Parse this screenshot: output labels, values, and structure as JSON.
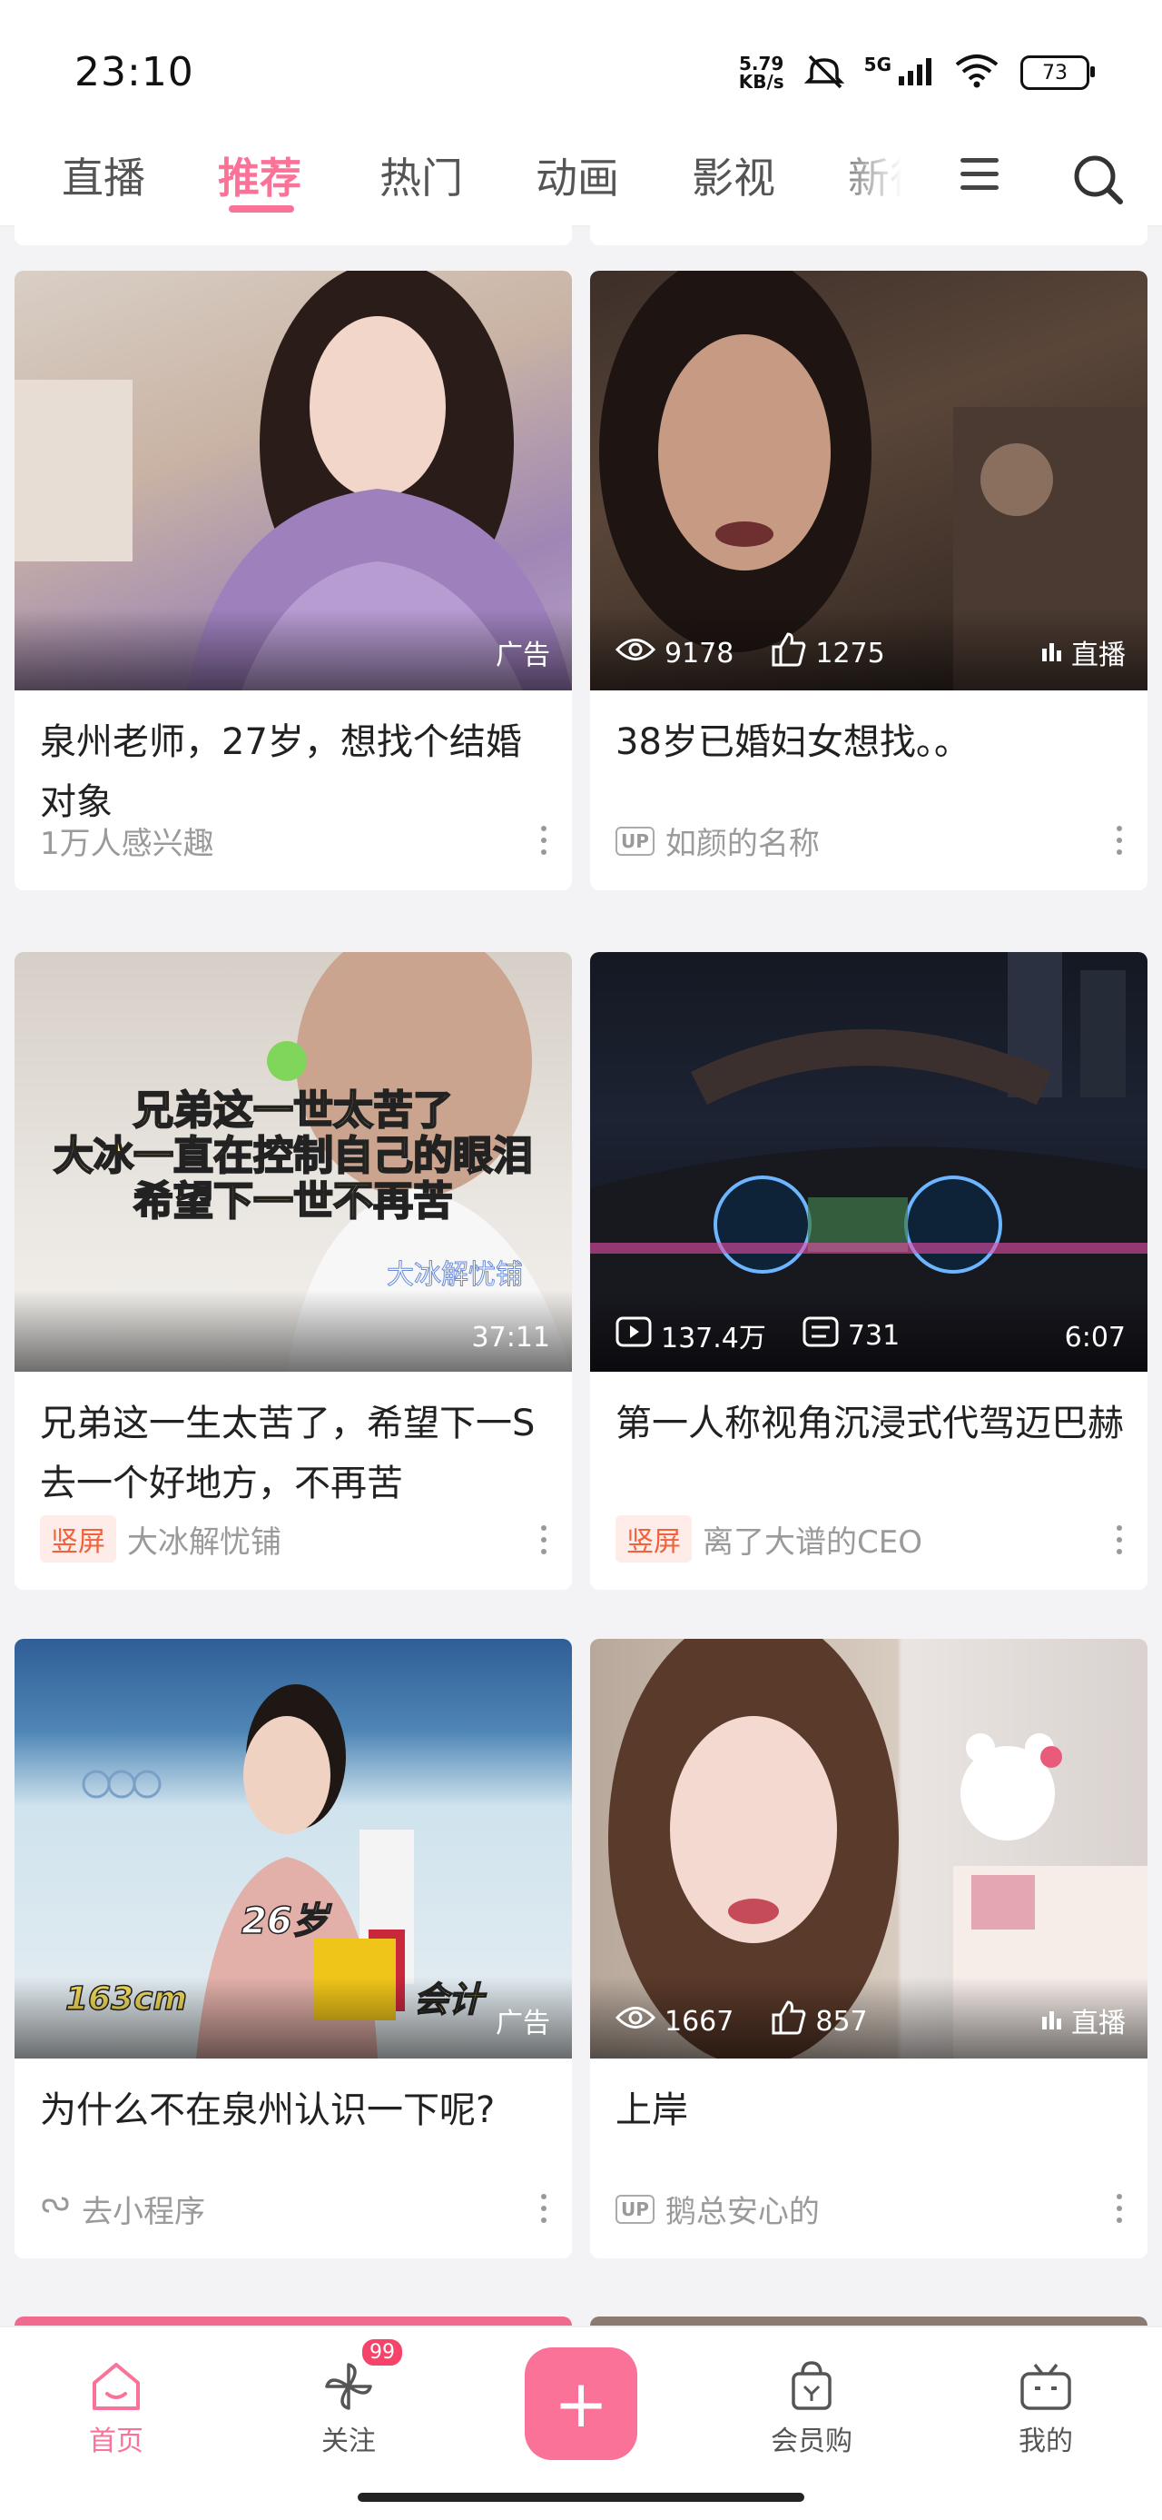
{
  "status_bar": {
    "time": "23:10",
    "net_speed_value": "5.79",
    "net_speed_unit": "KB/s",
    "network": "5G",
    "battery": "73",
    "icons": [
      "mute-icon",
      "signal-icon",
      "wifi-icon",
      "battery-icon"
    ]
  },
  "tabs": [
    {
      "label": "直播",
      "active": false
    },
    {
      "label": "推荐",
      "active": true
    },
    {
      "label": "热门",
      "active": false
    },
    {
      "label": "动画",
      "active": false
    },
    {
      "label": "影视",
      "active": false
    },
    {
      "label": "新征",
      "active": false
    }
  ],
  "accent_color": "#fb7299",
  "cards": [
    {
      "title": "泉州老师，27岁，想找个结婚对象",
      "tag": "广告",
      "meta": "1万人感兴趣"
    },
    {
      "title": "38岁已婚妇女想找。。",
      "views": "9178",
      "likes": "1275",
      "tag": "直播",
      "author": "如颜的名称"
    },
    {
      "title": "兄弟这一生太苦了，希望下一S去一个好地方，不再苦",
      "caption_lines": [
        "兄弟这一世太苦了",
        "大冰一直在控制自己的眼泪",
        "希望下一世不再苦"
      ],
      "watermark": "大冰解忧铺",
      "duration": "37:11",
      "badge": "竖屏",
      "author": "大冰解忧铺"
    },
    {
      "title": "第一人称视角沉浸式代驾迈巴赫",
      "plays": "137.4万",
      "danmaku": "731",
      "duration": "6:07",
      "badge": "竖屏",
      "author": "离了大谱的CEO"
    },
    {
      "title": "为什么不在泉州认识一下呢?",
      "overlay_texts": [
        "26岁",
        "163cm",
        "会计"
      ],
      "tag": "广告",
      "meta": "去小程序"
    },
    {
      "title": "上岸",
      "views": "1667",
      "likes": "857",
      "tag": "直播",
      "author": "鹅总安心的"
    }
  ],
  "up_label": "UP",
  "bottom_nav": {
    "home": "首页",
    "follow": "关注",
    "follow_badge": "99",
    "plus": "+",
    "shop": "会员购",
    "me": "我的"
  }
}
